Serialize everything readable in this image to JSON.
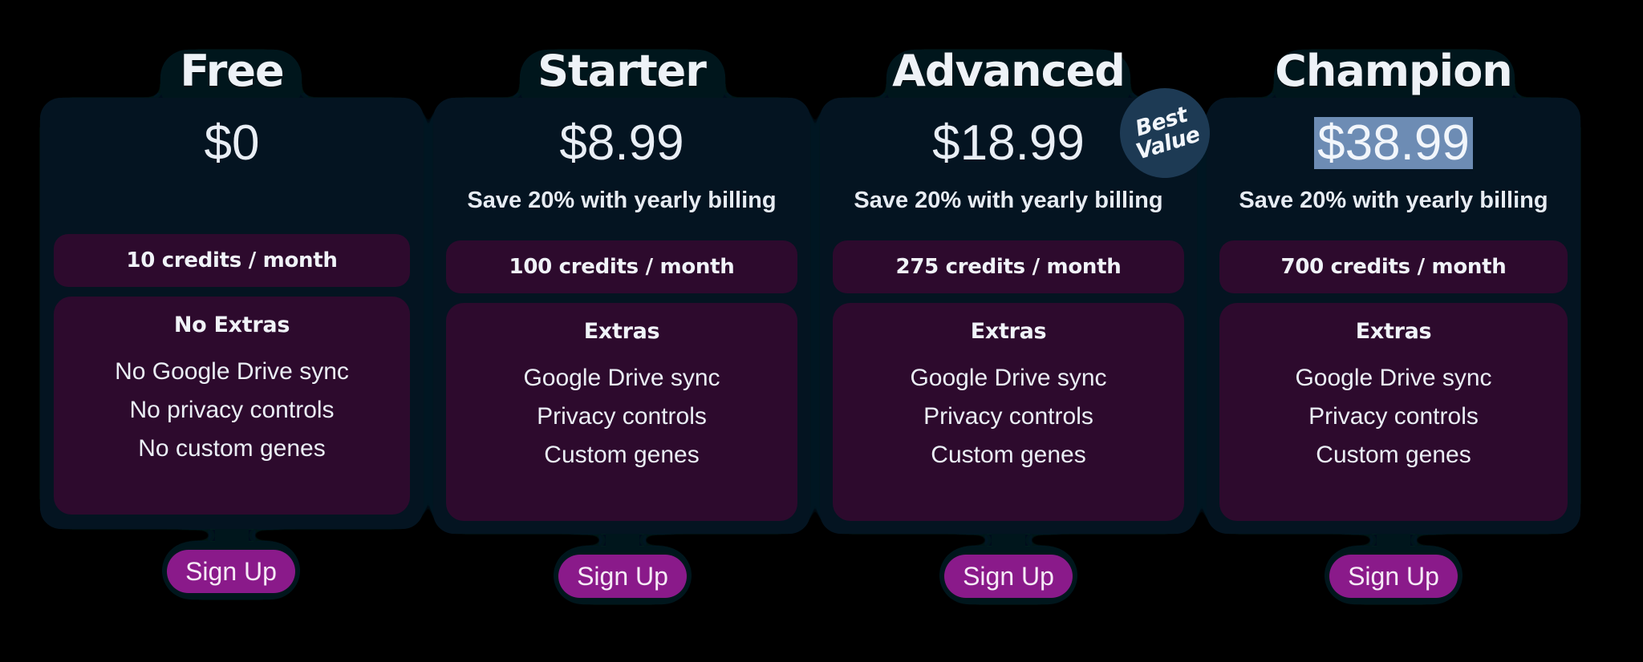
{
  "page": {
    "background_color": "#000000",
    "card_color": "#041421",
    "panel_color": "#2d0a2d",
    "button_color": "#8a1a8a",
    "badge_color": "#1d3a54",
    "selection_color": "#6d8cb4"
  },
  "badge": {
    "line1": "Best",
    "line2": "Value"
  },
  "plans": [
    {
      "name": "Free",
      "price": "$0",
      "save_note": "",
      "credits": "10 credits / month",
      "extras_title": "No Extras",
      "extras": [
        "No Google Drive sync",
        "No privacy controls",
        "No custom genes"
      ],
      "cta": "Sign Up",
      "price_selected": false,
      "has_badge": false
    },
    {
      "name": "Starter",
      "price": "$8.99",
      "save_note": "Save 20% with yearly billing",
      "credits": "100 credits / month",
      "extras_title": "Extras",
      "extras": [
        "Google Drive sync",
        "Privacy controls",
        "Custom genes"
      ],
      "cta": "Sign Up",
      "price_selected": false,
      "has_badge": false
    },
    {
      "name": "Advanced",
      "price": "$18.99",
      "save_note": "Save 20% with yearly billing",
      "credits": "275 credits / month",
      "extras_title": "Extras",
      "extras": [
        "Google Drive sync",
        "Privacy controls",
        "Custom genes"
      ],
      "cta": "Sign Up",
      "price_selected": false,
      "has_badge": true
    },
    {
      "name": "Champion",
      "price": "$38.99",
      "save_note": "Save 20% with yearly billing",
      "credits": "700 credits / month",
      "extras_title": "Extras",
      "extras": [
        "Google Drive sync",
        "Privacy controls",
        "Custom genes"
      ],
      "cta": "Sign Up",
      "price_selected": true,
      "has_badge": false
    }
  ]
}
